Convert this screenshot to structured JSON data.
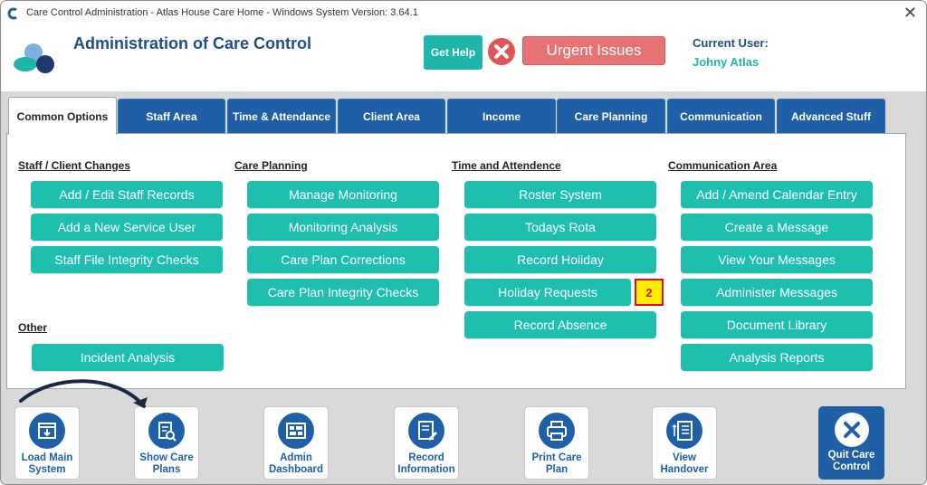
{
  "window": {
    "title": "Care Control Administration - Atlas House Care Home - Windows System Version: 3.64.1",
    "close_glyph": "✕"
  },
  "header": {
    "app_title": "Administration of Care Control",
    "get_help": "Get Help",
    "urgent": "Urgent Issues",
    "current_user_label": "Current User:",
    "current_user": "Johny Atlas"
  },
  "tabs": [
    "Common Options",
    "Staff Area",
    "Time & Attendance",
    "Client Area",
    "Income",
    "Care Planning",
    "Communication",
    "Advanced Stuff"
  ],
  "sections": {
    "staff_client": {
      "title": "Staff / Client Changes",
      "buttons": [
        "Add / Edit Staff Records",
        "Add a New Service User",
        "Staff File Integrity Checks"
      ]
    },
    "other": {
      "title": "Other",
      "buttons": [
        "Incident Analysis"
      ]
    },
    "care_planning": {
      "title": "Care Planning",
      "buttons": [
        "Manage Monitoring",
        "Monitoring Analysis",
        "Care Plan Corrections",
        "Care Plan Integrity Checks"
      ]
    },
    "time_att": {
      "title": "Time and Attendence",
      "buttons": [
        "Roster System",
        "Todays Rota",
        "Record Holiday",
        "Holiday Requests",
        "Record Absence"
      ],
      "holiday_badge": "2"
    },
    "communication": {
      "title": "Communication Area",
      "buttons": [
        "Add / Amend Calendar Entry",
        "Create a Message",
        "View Your Messages",
        "Administer Messages",
        "Document Library",
        "Analysis Reports"
      ]
    }
  },
  "bottom": [
    {
      "line1": "Load Main",
      "line2": "System",
      "icon": "download-window-icon"
    },
    {
      "line1": "Show Care",
      "line2": "Plans",
      "icon": "document-search-icon"
    },
    {
      "line1": "Admin",
      "line2": "Dashboard",
      "icon": "dashboard-icon"
    },
    {
      "line1": "Record",
      "line2": "Information",
      "icon": "document-edit-icon"
    },
    {
      "line1": "Print Care",
      "line2": "Plan",
      "icon": "printer-icon"
    },
    {
      "line1": "View",
      "line2": "Handover",
      "icon": "handover-list-icon"
    }
  ],
  "quit": {
    "line1": "Quit Care",
    "line2": "Control",
    "icon": "close-icon"
  },
  "colors": {
    "accent": "#1fbfb0",
    "brand": "#1f5fa8",
    "urgent": "#e57373",
    "badge_bg": "#ffee00",
    "badge_border": "#e01010"
  }
}
